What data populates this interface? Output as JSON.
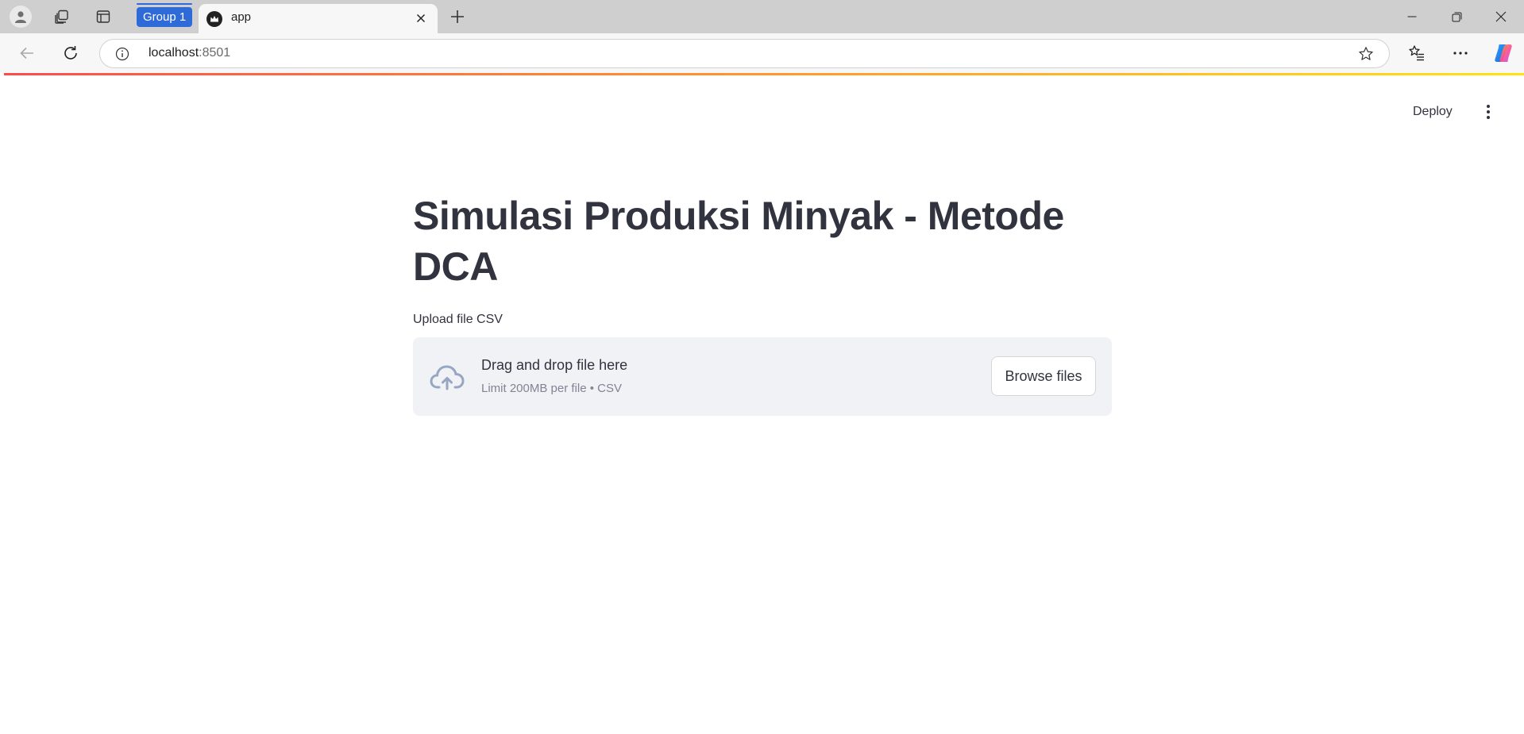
{
  "browser": {
    "tab_group_label": "Group 1",
    "active_tab_title": "app",
    "address_host": "localhost",
    "address_port": ":8501"
  },
  "app": {
    "header": {
      "deploy_label": "Deploy"
    },
    "title": "Simulasi Produksi Minyak - Metode DCA",
    "uploader": {
      "label": "Upload file CSV",
      "drop_text": "Drag and drop file here",
      "limit_text": "Limit 200MB per file • CSV",
      "browse_label": "Browse files"
    }
  },
  "icons": {
    "profile": "profile-icon",
    "workspaces": "workspaces-icon",
    "tab_actions": "tab-actions-icon",
    "favicon": "streamlit-crown-icon",
    "close_tab": "close-icon",
    "new_tab": "plus-icon",
    "back": "back-arrow-icon",
    "reload": "reload-icon",
    "site_info": "info-icon",
    "favorite": "star-icon",
    "favorites": "favorites-icon",
    "more": "more-icon",
    "copilot": "copilot-icon",
    "upload": "cloud-upload-icon",
    "main_menu": "kebab-menu-icon"
  },
  "colors": {
    "tab_group": "#2f6ad9",
    "decoration_start": "#ff4b4b",
    "decoration_end": "#ffe312",
    "text": "#31333f",
    "dropzone_bg": "#f0f2f6"
  }
}
